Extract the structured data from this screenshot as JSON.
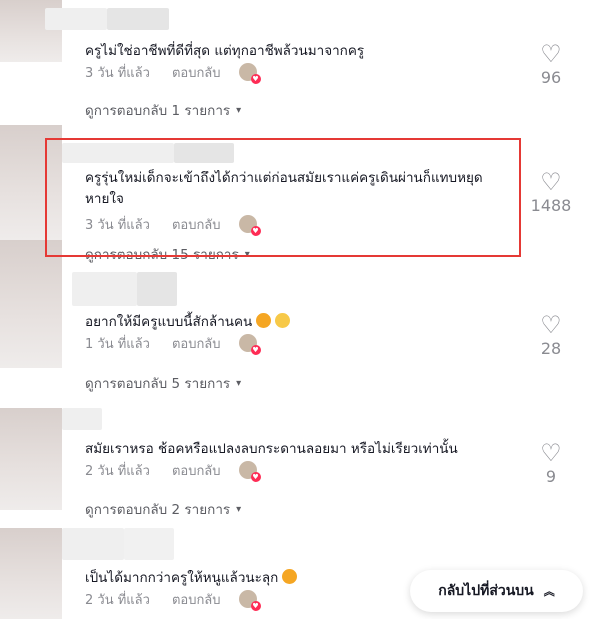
{
  "comments": [
    {
      "text": "ครูไม่ใช่อาชีพที่ดีที่สุด แต่ทุกอาชีพล้วนมาจากครู",
      "time": "3 วัน ที่แล้ว",
      "reply": "ตอบกลับ",
      "likes": "96",
      "view_replies": "ดูการตอบกลับ 1 รายการ"
    },
    {
      "text": "ครูรุ่นใหม่เด็กจะเข้าถึงได้กว่าแต่ก่อนสมัยเราแค่ครูเดินผ่านก็แทบหยุดหายใจ",
      "time": "3 วัน ที่แล้ว",
      "reply": "ตอบกลับ",
      "likes": "1488",
      "view_replies": "ดูการตอบกลับ 15 รายการ"
    },
    {
      "text": "อยากให้มีครูแบบนี้สักล้านคน",
      "time": "1 วัน ที่แล้ว",
      "reply": "ตอบกลับ",
      "likes": "28",
      "view_replies": "ดูการตอบกลับ 5 รายการ"
    },
    {
      "text": "สมัยเราหรอ ช้อคหรือแปลงลบกระดานลอยมา หรือไม่เรียวเท่านั้น",
      "time": "2 วัน ที่แล้ว",
      "reply": "ตอบกลับ",
      "likes": "9",
      "view_replies": "ดูการตอบกลับ 2 รายการ"
    },
    {
      "text": "เป็นได้มากกว่าครูให้หนูแล้วนะลุก",
      "time": "2 วัน ที่แล้ว",
      "reply": "ตอบกลับ"
    }
  ],
  "back_to_top": "กลับไปที่ส่วนบน",
  "icons": {
    "heart": "heart-outline-icon",
    "chevron": "chevron-down-icon",
    "up": "double-chevron-up-icon"
  },
  "colors": {
    "highlight": "#e53935",
    "muted": "#8a8b91",
    "text": "#161823",
    "accent": "#fe2c55"
  }
}
